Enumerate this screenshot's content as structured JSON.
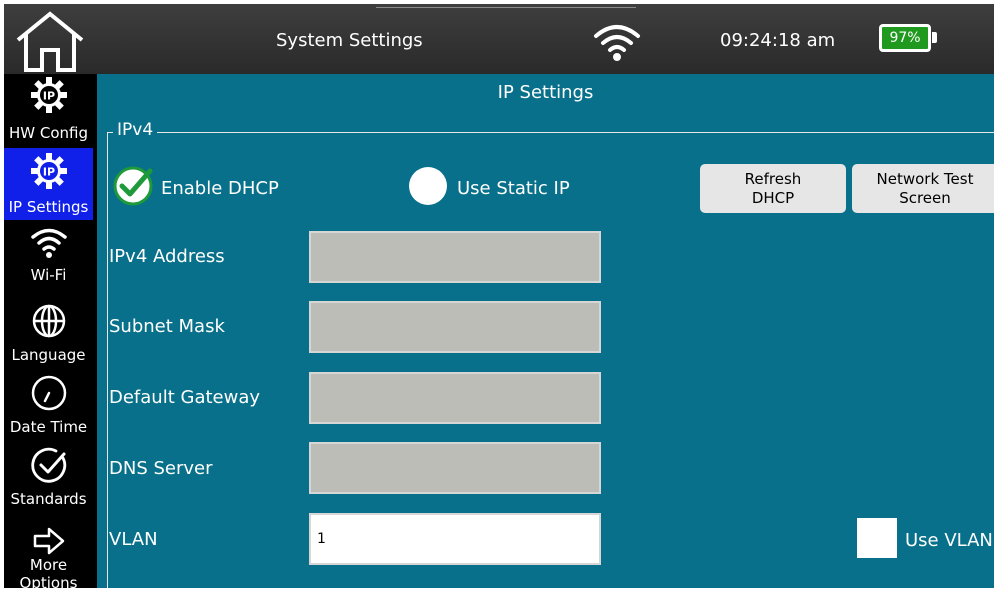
{
  "header": {
    "title": "System Settings",
    "time": "09:24:18 am",
    "battery": "97%",
    "battery_color": "#1f9a1f"
  },
  "sidebar": {
    "items": [
      {
        "label": "HW Config",
        "icon": "ip-gear-icon"
      },
      {
        "label": "IP Settings",
        "icon": "ip-gear-icon",
        "active": true
      },
      {
        "label": "Wi-Fi",
        "icon": "wifi-icon"
      },
      {
        "label": "Language",
        "icon": "globe-icon"
      },
      {
        "label": "Date Time",
        "icon": "clock-icon"
      },
      {
        "label": "Standards",
        "icon": "check-circle-icon"
      },
      {
        "label": "More\nOptions",
        "icon": "arrow-right-icon"
      }
    ],
    "active_color": "#1020e8"
  },
  "main": {
    "title": "IP Settings",
    "group_label": "IPv4",
    "enable_dhcp_label": "Enable DHCP",
    "enable_dhcp_checked": true,
    "static_ip_label": "Use Static IP",
    "static_ip_checked": false,
    "refresh_dhcp_label": "Refresh\nDHCP",
    "network_test_label": "Network Test\nScreen",
    "fields": {
      "ipv4_address": {
        "label": "IPv4 Address",
        "value": ""
      },
      "subnet_mask": {
        "label": "Subnet Mask",
        "value": ""
      },
      "default_gateway": {
        "label": "Default Gateway",
        "value": ""
      },
      "dns_server": {
        "label": "DNS Server",
        "value": ""
      },
      "vlan": {
        "label": "VLAN",
        "value": "1"
      }
    },
    "use_vlan_label": "Use VLAN",
    "use_vlan_checked": false,
    "background_color": "#08708a",
    "check_color": "#1e9a3a"
  }
}
